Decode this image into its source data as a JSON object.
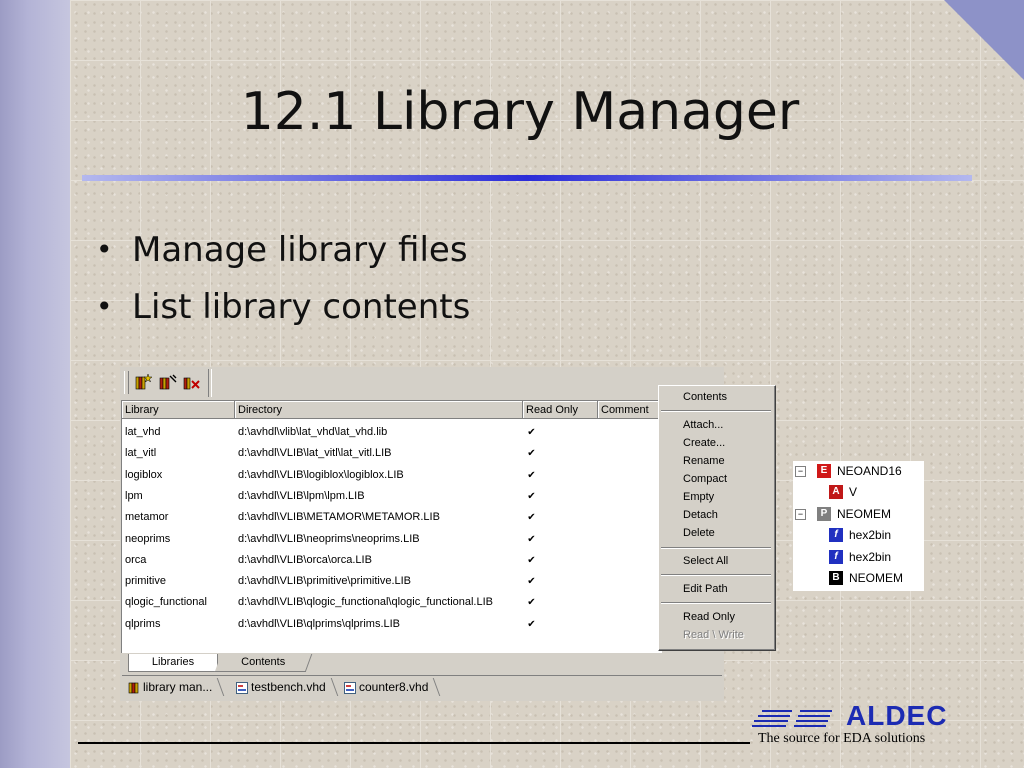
{
  "slide": {
    "title": "12.1 Library Manager",
    "bullets": [
      "Manage library files",
      "List library contents"
    ]
  },
  "toolbar": {
    "icons": [
      "new-library-icon",
      "attach-library-icon",
      "delete-library-icon"
    ]
  },
  "table": {
    "columns": [
      "Library",
      "Directory",
      "Read Only",
      "Comment"
    ],
    "rows": [
      {
        "library": "lat_vhd",
        "directory": "d:\\avhdl\\vlib\\lat_vhd\\lat_vhd.lib",
        "read_only": true
      },
      {
        "library": "lat_vitl",
        "directory": "d:\\avhdl\\VLIB\\lat_vitl\\lat_vitl.LIB",
        "read_only": true
      },
      {
        "library": "logiblox",
        "directory": "d:\\avhdl\\VLIB\\logiblox\\logiblox.LIB",
        "read_only": true
      },
      {
        "library": "lpm",
        "directory": "d:\\avhdl\\VLIB\\lpm\\lpm.LIB",
        "read_only": true
      },
      {
        "library": "metamor",
        "directory": "d:\\avhdl\\VLIB\\METAMOR\\METAMOR.LIB",
        "read_only": true
      },
      {
        "library": "neoprims",
        "directory": "d:\\avhdl\\VLIB\\neoprims\\neoprims.LIB",
        "read_only": true
      },
      {
        "library": "orca",
        "directory": "d:\\avhdl\\VLIB\\orca\\orca.LIB",
        "read_only": true
      },
      {
        "library": "primitive",
        "directory": "d:\\avhdl\\VLIB\\primitive\\primitive.LIB",
        "read_only": true
      },
      {
        "library": "qlogic_functional",
        "directory": "d:\\avhdl\\VLIB\\qlogic_functional\\qlogic_functional.LIB",
        "read_only": true
      },
      {
        "library": "qlprims",
        "directory": "d:\\avhdl\\VLIB\\qlprims\\qlprims.LIB",
        "read_only": true
      }
    ]
  },
  "panel_tabs": [
    "Libraries",
    "Contents"
  ],
  "doc_tabs": [
    "library man...",
    "testbench.vhd",
    "counter8.vhd"
  ],
  "context_menu": {
    "items": [
      {
        "label": "Contents",
        "enabled": true
      },
      {
        "label": "Attach...",
        "enabled": true
      },
      {
        "label": "Create...",
        "enabled": true
      },
      {
        "label": "Rename",
        "enabled": true
      },
      {
        "label": "Compact",
        "enabled": true
      },
      {
        "label": "Empty",
        "enabled": true
      },
      {
        "label": "Detach",
        "enabled": true
      },
      {
        "label": "Delete",
        "enabled": true
      },
      {
        "label": "Select All",
        "enabled": true
      },
      {
        "label": "Edit Path",
        "enabled": true
      },
      {
        "label": "Read Only",
        "enabled": true
      },
      {
        "label": "Read \\ Write",
        "enabled": false
      }
    ]
  },
  "tree": {
    "nodes": [
      {
        "badge": "E",
        "label": "NEOAND16",
        "badge_color": "#d01818",
        "expanded": true
      },
      {
        "badge": "A",
        "label": "V",
        "badge_color": "#c01818"
      },
      {
        "badge": "P",
        "label": "NEOMEM",
        "badge_color": "#808080",
        "expanded": true
      },
      {
        "badge": "f",
        "label": "hex2bin",
        "badge_color": "#2030c0"
      },
      {
        "badge": "f",
        "label": "hex2bin",
        "badge_color": "#2030c0"
      },
      {
        "badge": "B",
        "label": "NEOMEM",
        "badge_color": "#000000"
      }
    ]
  },
  "footer": {
    "logo": "ALDEC",
    "tagline": "The source for EDA solutions"
  },
  "colors": {
    "accent": "#2b2cd8",
    "logo": "#1c2bb3"
  }
}
